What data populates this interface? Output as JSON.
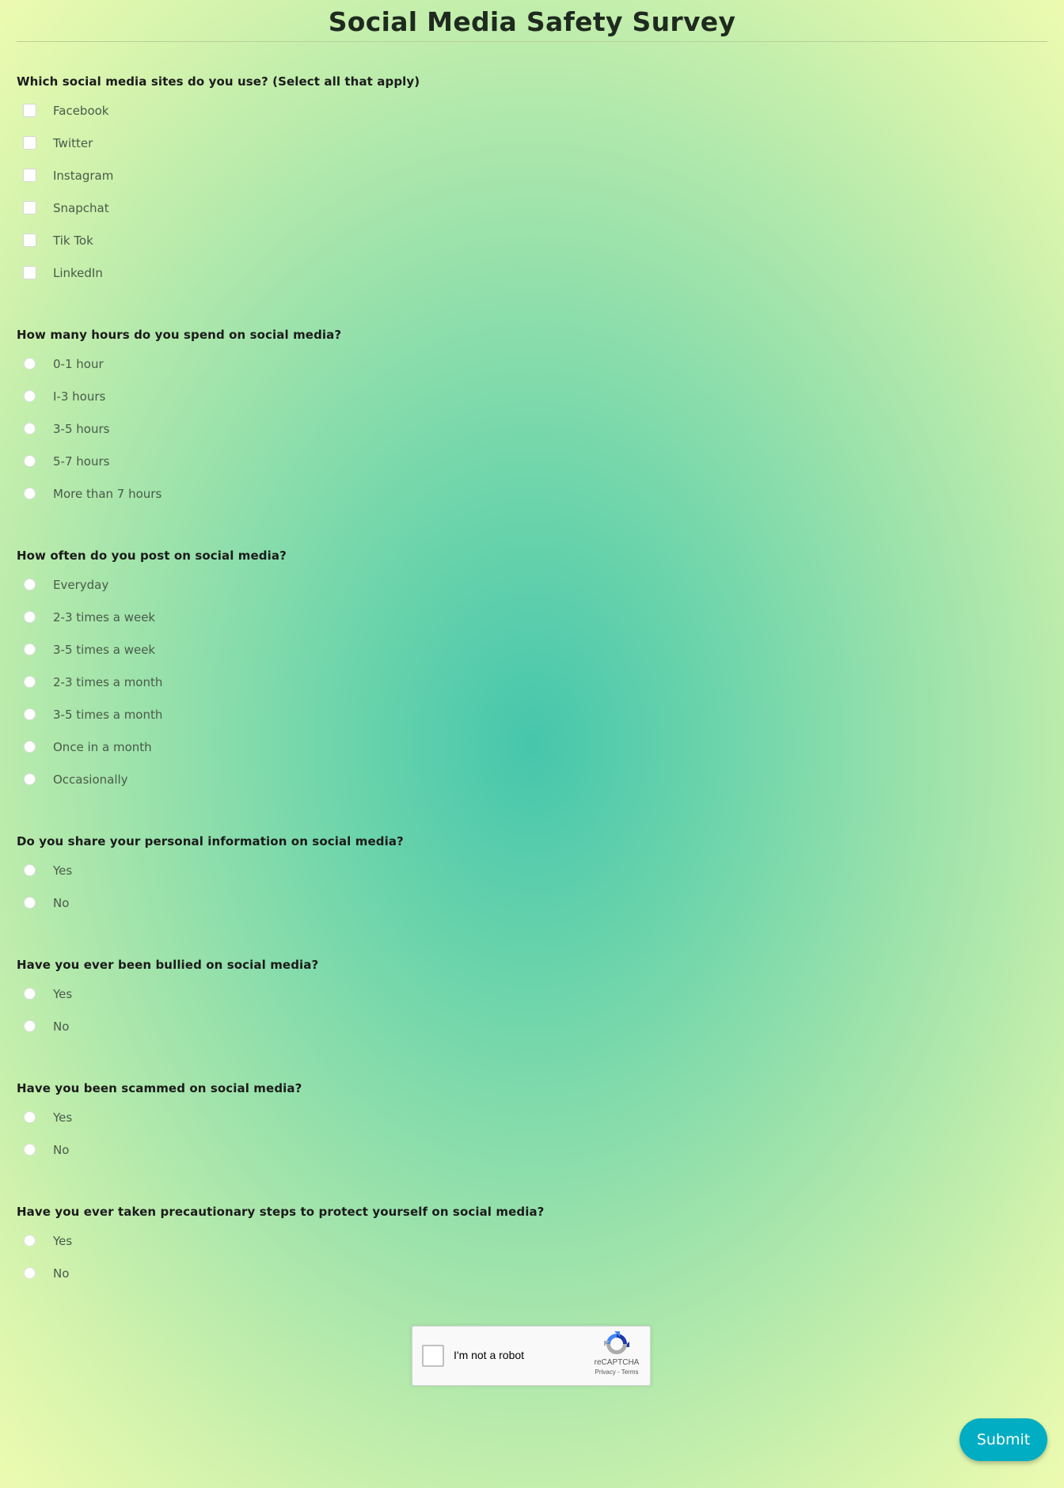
{
  "page": {
    "title": "Social Media Safety Survey"
  },
  "questions": [
    {
      "label": "Which social media sites do you use? (Select all that apply)",
      "type": "checkbox",
      "options": [
        "Facebook",
        "Twitter",
        "Instagram",
        "Snapchat",
        "Tik Tok",
        "LinkedIn"
      ]
    },
    {
      "label": "How many hours do you spend on social media?",
      "type": "radio",
      "options": [
        "0-1 hour",
        "I-3 hours",
        "3-5 hours",
        "5-7 hours",
        "More than 7 hours"
      ]
    },
    {
      "label": "How often do you post on social media?",
      "type": "radio",
      "options": [
        "Everyday",
        "2-3 times a week",
        "3-5 times a week",
        "2-3 times a month",
        "3-5 times a month",
        "Once in a month",
        "Occasionally"
      ]
    },
    {
      "label": "Do you share your personal information on social media?",
      "type": "radio",
      "options": [
        "Yes",
        "No"
      ]
    },
    {
      "label": "Have you ever been bullied on social media?",
      "type": "radio",
      "options": [
        "Yes",
        "No"
      ]
    },
    {
      "label": "Have you been scammed on social media?",
      "type": "radio",
      "options": [
        "Yes",
        "No"
      ]
    },
    {
      "label": "Have you ever taken precautionary steps to protect yourself on social media?",
      "type": "radio",
      "options": [
        "Yes",
        "No"
      ]
    }
  ],
  "captcha": {
    "label": "I'm not a robot",
    "brand": "reCAPTCHA",
    "privacy": "Privacy",
    "separator": " - ",
    "terms": "Terms",
    "icon": "recaptcha-logo"
  },
  "submit": {
    "label": "Submit",
    "color": "#00adc2"
  },
  "colors": {
    "background_center": "#46c6ac",
    "background_edge": "#f0fcb0"
  }
}
